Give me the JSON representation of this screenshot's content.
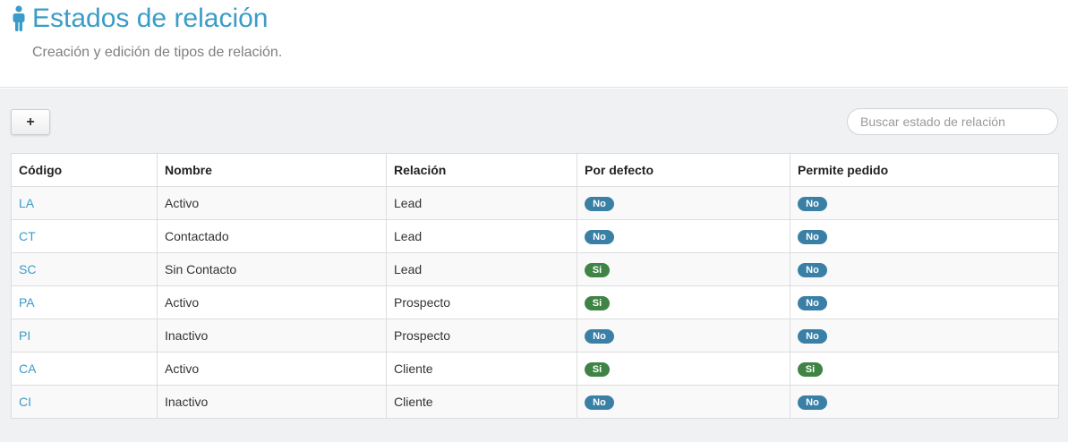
{
  "header": {
    "title": "Estados de relación",
    "subtitle": "Creación y edición de tipos de relación.",
    "icon": "person-icon",
    "title_color": "#3a9cc8"
  },
  "toolbar": {
    "add_label": "+",
    "search_placeholder": "Buscar estado de relación",
    "search_value": ""
  },
  "table": {
    "columns": [
      "Código",
      "Nombre",
      "Relación",
      "Por defecto",
      "Permite pedido"
    ],
    "rows": [
      {
        "codigo": "LA",
        "nombre": "Activo",
        "relacion": "Lead",
        "por_defecto": "No",
        "permite_pedido": "No"
      },
      {
        "codigo": "CT",
        "nombre": "Contactado",
        "relacion": "Lead",
        "por_defecto": "No",
        "permite_pedido": "No"
      },
      {
        "codigo": "SC",
        "nombre": "Sin Contacto",
        "relacion": "Lead",
        "por_defecto": "Si",
        "permite_pedido": "No"
      },
      {
        "codigo": "PA",
        "nombre": "Activo",
        "relacion": "Prospecto",
        "por_defecto": "Si",
        "permite_pedido": "No"
      },
      {
        "codigo": "PI",
        "nombre": "Inactivo",
        "relacion": "Prospecto",
        "por_defecto": "No",
        "permite_pedido": "No"
      },
      {
        "codigo": "CA",
        "nombre": "Activo",
        "relacion": "Cliente",
        "por_defecto": "Si",
        "permite_pedido": "Si"
      },
      {
        "codigo": "CI",
        "nombre": "Inactivo",
        "relacion": "Cliente",
        "por_defecto": "No",
        "permite_pedido": "No"
      }
    ]
  },
  "colors": {
    "badge_no": "#3a80a6",
    "badge_si": "#3f8444",
    "link": "#3a9cc8"
  }
}
